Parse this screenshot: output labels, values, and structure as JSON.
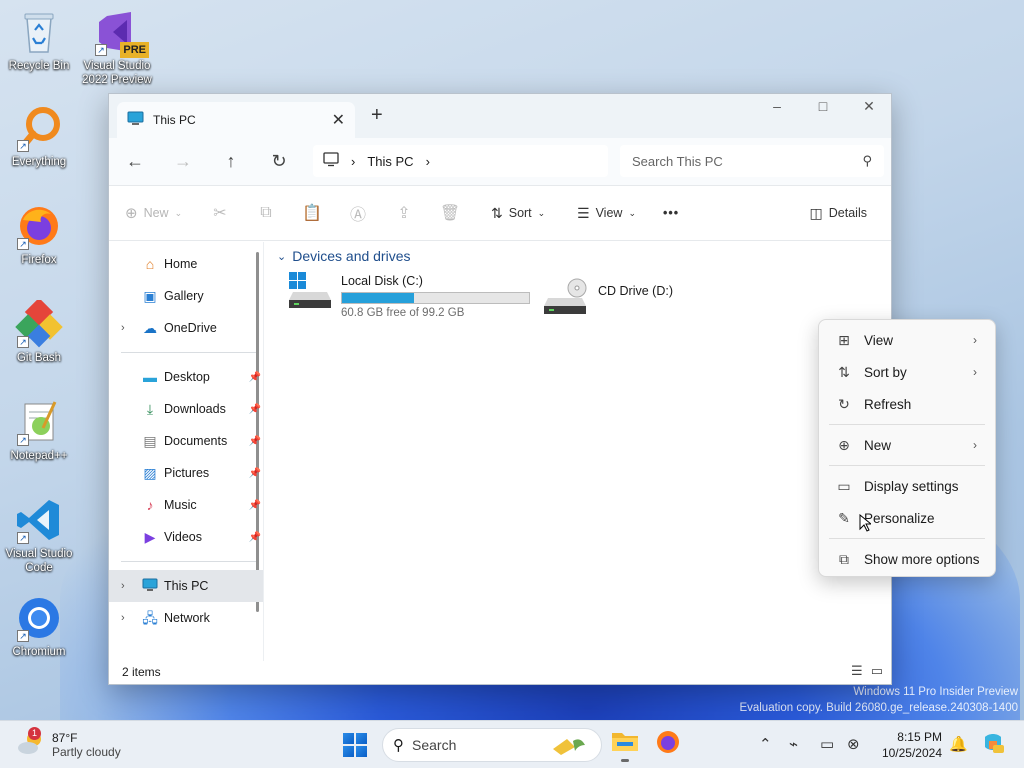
{
  "desktop": {
    "icons": [
      {
        "label": "Recycle Bin"
      },
      {
        "label": "Visual Studio 2022 Preview",
        "badge": "PRE"
      },
      {
        "label": "Everything"
      },
      {
        "label": "Firefox"
      },
      {
        "label": "Git Bash"
      },
      {
        "label": "Notepad++"
      },
      {
        "label": "Visual Studio Code"
      },
      {
        "label": "Chromium"
      }
    ],
    "watermark": {
      "line1": "Windows 11 Pro Insider Preview",
      "line2": "Evaluation copy. Build 26080.ge_release.240308-1400"
    }
  },
  "window": {
    "tab_title": "This PC",
    "controls": {
      "minimize": "–",
      "maximize": "□",
      "close": "✕"
    },
    "address": {
      "location": "This PC"
    },
    "search": {
      "placeholder": "Search This PC"
    },
    "toolbar": {
      "new_label": "New",
      "sort_label": "Sort",
      "view_label": "View",
      "more_label": "•••",
      "details_label": "Details"
    },
    "nav": {
      "quick": [
        {
          "label": "Home"
        },
        {
          "label": "Gallery"
        },
        {
          "label": "OneDrive"
        }
      ],
      "pinned": [
        {
          "label": "Desktop"
        },
        {
          "label": "Downloads"
        },
        {
          "label": "Documents"
        },
        {
          "label": "Pictures"
        },
        {
          "label": "Music"
        },
        {
          "label": "Videos"
        }
      ],
      "locations": [
        {
          "label": "This PC"
        },
        {
          "label": "Network"
        }
      ]
    },
    "content": {
      "group_title": "Devices and drives",
      "drives": [
        {
          "name": "Local Disk (C:)",
          "free_text": "60.8 GB free of 99.2 GB",
          "used_fraction": 0.387
        },
        {
          "name": "CD Drive (D:)"
        }
      ]
    },
    "status": {
      "items": "2 items"
    }
  },
  "context_menu": {
    "items": [
      {
        "label": "View"
      },
      {
        "label": "Sort by"
      },
      {
        "label": "Refresh"
      },
      {
        "label": "New"
      },
      {
        "label": "Display settings"
      },
      {
        "label": "Personalize"
      },
      {
        "label": "Show more options"
      }
    ]
  },
  "taskbar": {
    "weather": {
      "badge": "1",
      "temp": "87°F",
      "condition": "Partly cloudy"
    },
    "search_label": "Search",
    "clock": {
      "time": "8:15 PM",
      "date": "10/25/2024"
    }
  },
  "colors": {
    "accent": "#0078d4",
    "drive_bar": "#26a0da",
    "group_header": "#1f4e8c"
  }
}
